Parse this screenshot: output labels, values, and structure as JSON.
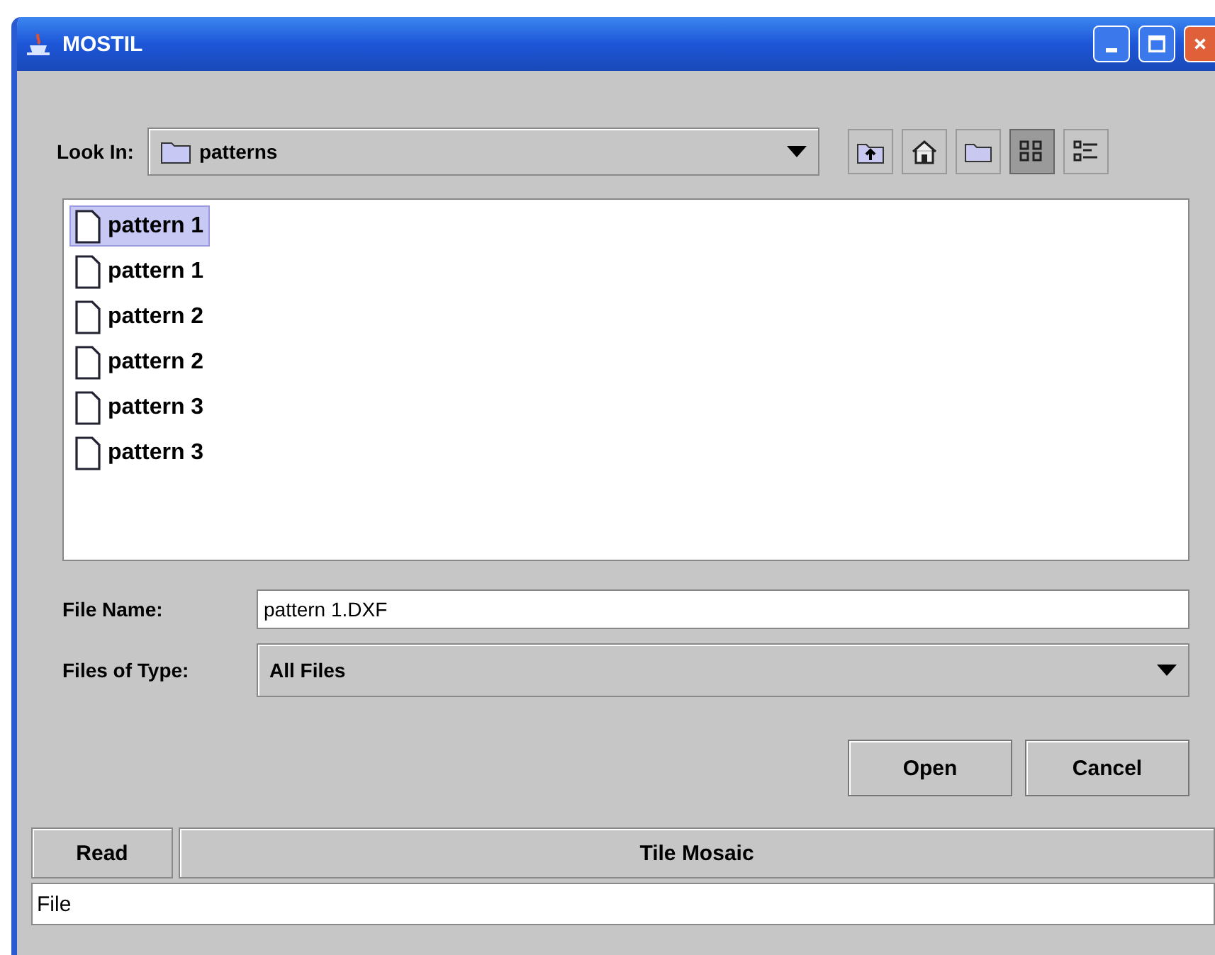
{
  "window": {
    "title": "MOSTIL"
  },
  "look_in": {
    "label": "Look In:",
    "value": "patterns"
  },
  "toolbar": [
    {
      "kind": "up",
      "selected": false
    },
    {
      "kind": "home",
      "selected": false
    },
    {
      "kind": "newfolder",
      "selected": false
    },
    {
      "kind": "list",
      "selected": true
    },
    {
      "kind": "details",
      "selected": false
    }
  ],
  "files": [
    {
      "name": "pattern 1",
      "selected": true
    },
    {
      "name": "pattern 1",
      "selected": false
    },
    {
      "name": "pattern 2",
      "selected": false
    },
    {
      "name": "pattern 2",
      "selected": false
    },
    {
      "name": "pattern 3",
      "selected": false
    },
    {
      "name": "pattern 3",
      "selected": false
    }
  ],
  "file_name": {
    "label": "File Name:",
    "value": "pattern 1.DXF"
  },
  "files_of_type": {
    "label": "Files of Type:",
    "value": "All Files"
  },
  "buttons": [
    "Open",
    "Cancel"
  ],
  "bottom_tabs": [
    "Read",
    "Tile Mosaic"
  ],
  "bottom_field": {
    "value": "File"
  }
}
